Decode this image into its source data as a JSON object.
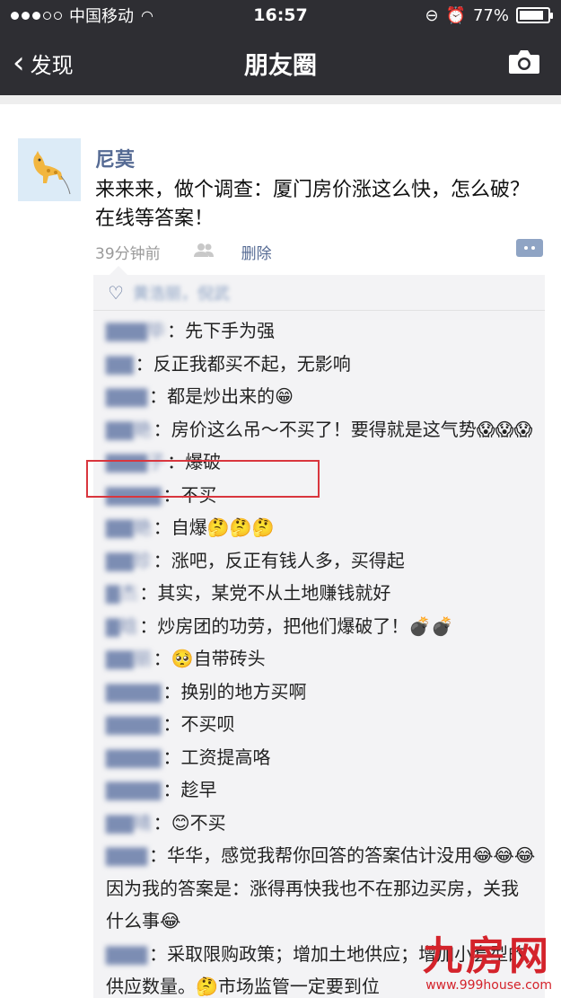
{
  "status_bar": {
    "carrier": "中国移动",
    "time": "16:57",
    "battery": "77%",
    "battery_level": 0.77
  },
  "nav": {
    "back_label": "发现",
    "title": "朋友圈"
  },
  "post": {
    "author": "尼莫",
    "content": "来来来，做个调查：厦门房价涨这么快，怎么破？在线等答案！",
    "time": "39分钟前",
    "delete_label": "删除",
    "likes": "黄浩丽，倪武"
  },
  "comments": [
    {
      "name": "▇▇▇毕",
      "text": "先下手为强"
    },
    {
      "name": "▇▇",
      "text": "反正我都买不起，无影响"
    },
    {
      "name": "▇▇▇",
      "text": "都是炒出来的😁"
    },
    {
      "name": "▇▇艳",
      "text": "房价这么吊～不买了！要得就是这气势😱😱😱"
    },
    {
      "name": "▇▇▇子",
      "text": "爆破"
    },
    {
      "name": "▇▇▇▇",
      "text": "不买"
    },
    {
      "name": "▇▇艳",
      "text": "自爆🤔🤔🤔"
    },
    {
      "name": "▇▇珍",
      "text": "涨吧，反正有钱人多，买得起"
    },
    {
      "name": "▇杰",
      "text": "其实，某党不从土地赚钱就好"
    },
    {
      "name": "▇晗",
      "text": "炒房团的功劳，把他们爆破了！💣💣"
    },
    {
      "name": "▇▇丽",
      "text": "🥺自带砖头"
    },
    {
      "name": "▇▇▇▇",
      "text": "换别的地方买啊"
    },
    {
      "name": "▇▇▇▇",
      "text": "不买呗"
    },
    {
      "name": "▇▇▇▇",
      "text": "工资提高咯"
    },
    {
      "name": "▇▇▇▇",
      "text": "趁早"
    },
    {
      "name": "▇▇晴",
      "text": "😊不买"
    },
    {
      "name": "▇▇▇",
      "text": "华华，感觉我帮你回答的答案估计没用😂😂😂因为我的答案是：涨得再快我也不在那边买房，关我什么事😂"
    },
    {
      "name": "▇▇▇",
      "text": "采取限购政策；增加土地供应；增加小套型的供应数量。🤔市场监管一定要到位"
    }
  ],
  "watermark": {
    "logo": "九房网",
    "url": "www.999house.com"
  }
}
